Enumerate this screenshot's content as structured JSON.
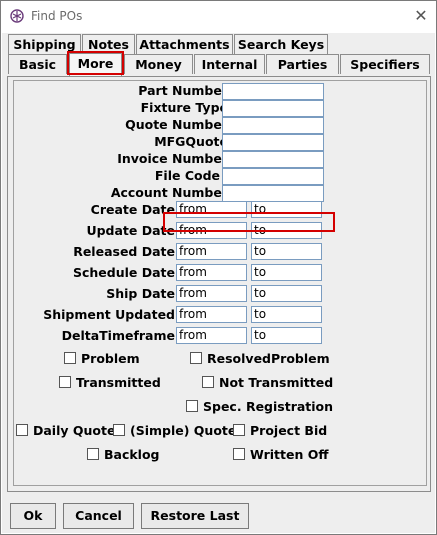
{
  "window": {
    "title": "Find POs",
    "close_glyph": "✕"
  },
  "tabs_row1": [
    {
      "label": "Shipping"
    },
    {
      "label": "Notes"
    },
    {
      "label": "Attachments"
    },
    {
      "label": "Search Keys"
    }
  ],
  "tabs_row2": [
    {
      "label": "Basic"
    },
    {
      "label": "More",
      "selected": true
    },
    {
      "label": "Money"
    },
    {
      "label": "Internal"
    },
    {
      "label": "Parties"
    },
    {
      "label": "Specifiers"
    }
  ],
  "text_fields": [
    {
      "label": "Part Number",
      "value": ""
    },
    {
      "label": "Fixture Type",
      "value": ""
    },
    {
      "label": "Quote Number",
      "value": ""
    },
    {
      "label": "MFGQuote",
      "value": ""
    },
    {
      "label": "Invoice Number",
      "value": ""
    },
    {
      "label": "File Code",
      "value": ""
    },
    {
      "label": "Account Number",
      "value": ""
    }
  ],
  "date_fields": [
    {
      "label": "Create Date",
      "from": "from",
      "to": "to"
    },
    {
      "label": "Update Date",
      "from": "from",
      "to": "to"
    },
    {
      "label": "Released Date",
      "from": "from",
      "to": "to"
    },
    {
      "label": "Schedule Date",
      "from": "from",
      "to": "to"
    },
    {
      "label": "Ship Date",
      "from": "from",
      "to": "to"
    },
    {
      "label": "Shipment Updated",
      "from": "from",
      "to": "to"
    },
    {
      "label": "DeltaTimeframe",
      "from": "from",
      "to": "to"
    }
  ],
  "checkboxes": {
    "problem": {
      "label": "Problem",
      "checked": false
    },
    "resolved_problem": {
      "label": "ResolvedProblem",
      "checked": false
    },
    "transmitted": {
      "label": "Transmitted",
      "checked": false
    },
    "not_transmitted": {
      "label": "Not Transmitted",
      "checked": false
    },
    "spec_registration": {
      "label": "Spec. Registration",
      "checked": false
    },
    "daily_quote": {
      "label": "Daily Quote",
      "checked": false
    },
    "simple_quote": {
      "label": "(Simple) Quote",
      "checked": false
    },
    "project_bid": {
      "label": "Project Bid",
      "checked": false
    },
    "backlog": {
      "label": "Backlog",
      "checked": false
    },
    "written_off": {
      "label": "Written Off",
      "checked": false
    }
  },
  "buttons": {
    "ok": "Ok",
    "cancel": "Cancel",
    "restore_last": "Restore Last"
  },
  "colors": {
    "highlight": "#d40000",
    "field_border": "#7a9cc0",
    "background": "#eeeeee"
  }
}
